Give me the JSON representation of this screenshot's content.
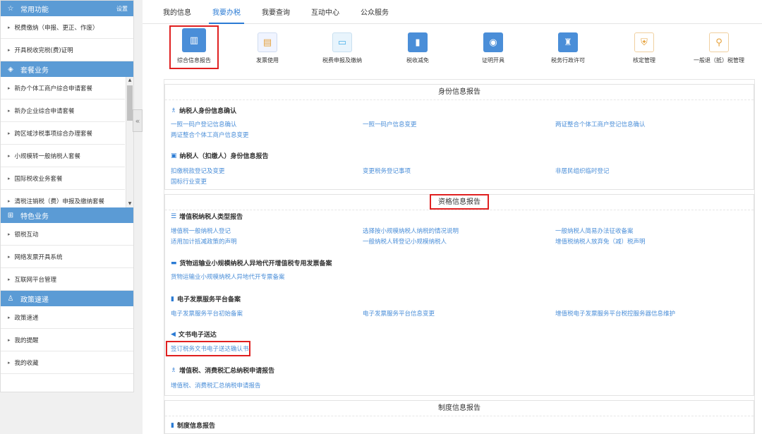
{
  "sidebar": {
    "sections": [
      {
        "title": "常用功能",
        "setting": "设置",
        "items": [
          "税费缴纳（申报、更正、作废）",
          "开具税收完税(费)证明"
        ]
      },
      {
        "title": "套餐业务",
        "items": [
          "新办个体工商户综合申请套餐",
          "新办企业综合申请套餐",
          "跨区域涉税事项综合办理套餐",
          "小规模转一般纳税人套餐",
          "国际税收业务套餐",
          "清税注销税（费）申报及缴纳套餐"
        ]
      },
      {
        "title": "特色业务",
        "items": [
          "银税互动",
          "网络发票开具系统",
          "互联网平台管理"
        ]
      },
      {
        "title": "政策速递",
        "items": [
          "政策速递",
          "我的提醒",
          "我的收藏"
        ]
      }
    ]
  },
  "collapse_icon": "double-chevron-left",
  "topnav": {
    "tabs": [
      "我的信息",
      "我要办税",
      "我要查询",
      "互动中心",
      "公众服务"
    ],
    "active": 1
  },
  "iconbar": [
    {
      "label": "综合信息报告",
      "icon": "monitor-chart-icon",
      "color": "#4a8ed8"
    },
    {
      "label": "发票使用",
      "icon": "invoice-icon",
      "color": "#e6a23c"
    },
    {
      "label": "税费申报及缴纳",
      "icon": "screen-icon",
      "color": "#4ab0e8"
    },
    {
      "label": "税收减免",
      "icon": "bar-chart-icon",
      "color": "#4a8ed8"
    },
    {
      "label": "证明开具",
      "icon": "certificate-icon",
      "color": "#4a8ed8"
    },
    {
      "label": "税务行政许可",
      "icon": "license-icon",
      "color": "#4a8ed8"
    },
    {
      "label": "核定管理",
      "icon": "shield-icon",
      "color": "#e6a23c"
    },
    {
      "label": "一般退（抵）税管理",
      "icon": "hierarchy-icon",
      "color": "#e6a23c"
    }
  ],
  "sections": {
    "identity": {
      "title": "身份信息报告",
      "g1_title": "纳税人身份信息确认",
      "g1_links": [
        "一照一码户登记信息确认",
        "一照一码户信息变更",
        "两证整合个体工商户登记信息确认",
        "两证整合个体工商户信息变更"
      ],
      "g2_title": "纳税人（扣缴人）身份信息报告",
      "g2_links": [
        "扣缴税款登记及变更",
        "变更税务登记事项",
        "非居民组织临时登记",
        "国标行业变更"
      ]
    },
    "qualification": {
      "title": "资格信息报告",
      "g1_title": "增值税纳税人类型报告",
      "g1_links": [
        "增值税一般纳税人登记",
        "选择按小规模纳税人纳税的情况说明",
        "一般纳税人简易办法征收备案",
        "适用加计抵减政策的声明",
        "一般纳税人转登记小规模纳税人",
        "增值税纳税人放弃免（减）税声明"
      ],
      "g2_title": "货物运输业小规模纳税人异地代开增值税专用发票备案",
      "g2_links": [
        "货物运输业小规模纳税人异地代开专票备案"
      ],
      "g3_title": "电子发票服务平台备案",
      "g3_links": [
        "电子发票服务平台初始备案",
        "电子发票服务平台信息变更",
        "增值税电子发票服务平台税控服务器信息维护"
      ],
      "g4_title": "文书电子送达",
      "g4_links": [
        "签订税务文书电子送达确认书"
      ],
      "g5_title": "增值税、消费税汇总纳税申请报告",
      "g5_links": [
        "增值税、消费税汇总纳税申请报告"
      ]
    },
    "system": {
      "title": "制度信息报告",
      "g1_title": "制度信息报告"
    }
  }
}
